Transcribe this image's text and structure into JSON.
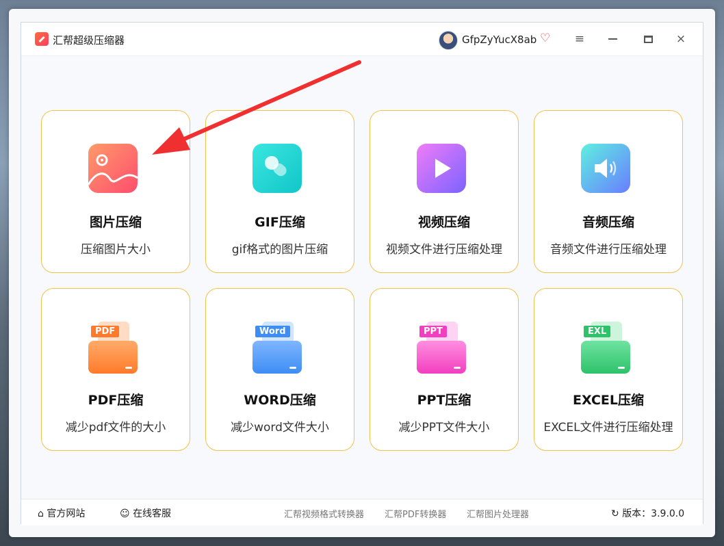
{
  "app": {
    "title": "汇帮超级压缩器"
  },
  "user": {
    "name": "GfpZyYucX8ab",
    "vip_icon": "diamond-icon"
  },
  "window_controls": {
    "menu": "≡",
    "minimize": "",
    "maximize": "",
    "close": "×"
  },
  "cards": [
    {
      "title": "图片压缩",
      "desc": "压缩图片大小",
      "icon": "image-icon"
    },
    {
      "title": "GIF压缩",
      "desc": "gif格式的图片压缩",
      "icon": "gif-icon"
    },
    {
      "title": "视频压缩",
      "desc": "视频文件进行压缩处理",
      "icon": "video-play-icon"
    },
    {
      "title": "音频压缩",
      "desc": "音频文件进行压缩处理",
      "icon": "speaker-icon"
    },
    {
      "title": "PDF压缩",
      "desc": "减少pdf文件的大小",
      "tag": "PDF",
      "color": "#ff7a2a"
    },
    {
      "title": "WORD压缩",
      "desc": "减少word文件大小",
      "tag": "Word",
      "color": "#3d8df5"
    },
    {
      "title": "PPT压缩",
      "desc": "减少PPT文件大小",
      "tag": "PPT",
      "color": "#f23fbf"
    },
    {
      "title": "EXCEL压缩",
      "desc": "EXCEL文件进行压缩处理",
      "tag": "EXL",
      "color": "#2ec26a"
    }
  ],
  "footer": {
    "website": "官方网站",
    "support": "在线客服",
    "links": [
      "汇帮视频格式转换器",
      "汇帮PDF转换器",
      "汇帮图片处理器"
    ],
    "version": "版本：3.9.0.0"
  },
  "annotation": {
    "color": "#f03030"
  }
}
